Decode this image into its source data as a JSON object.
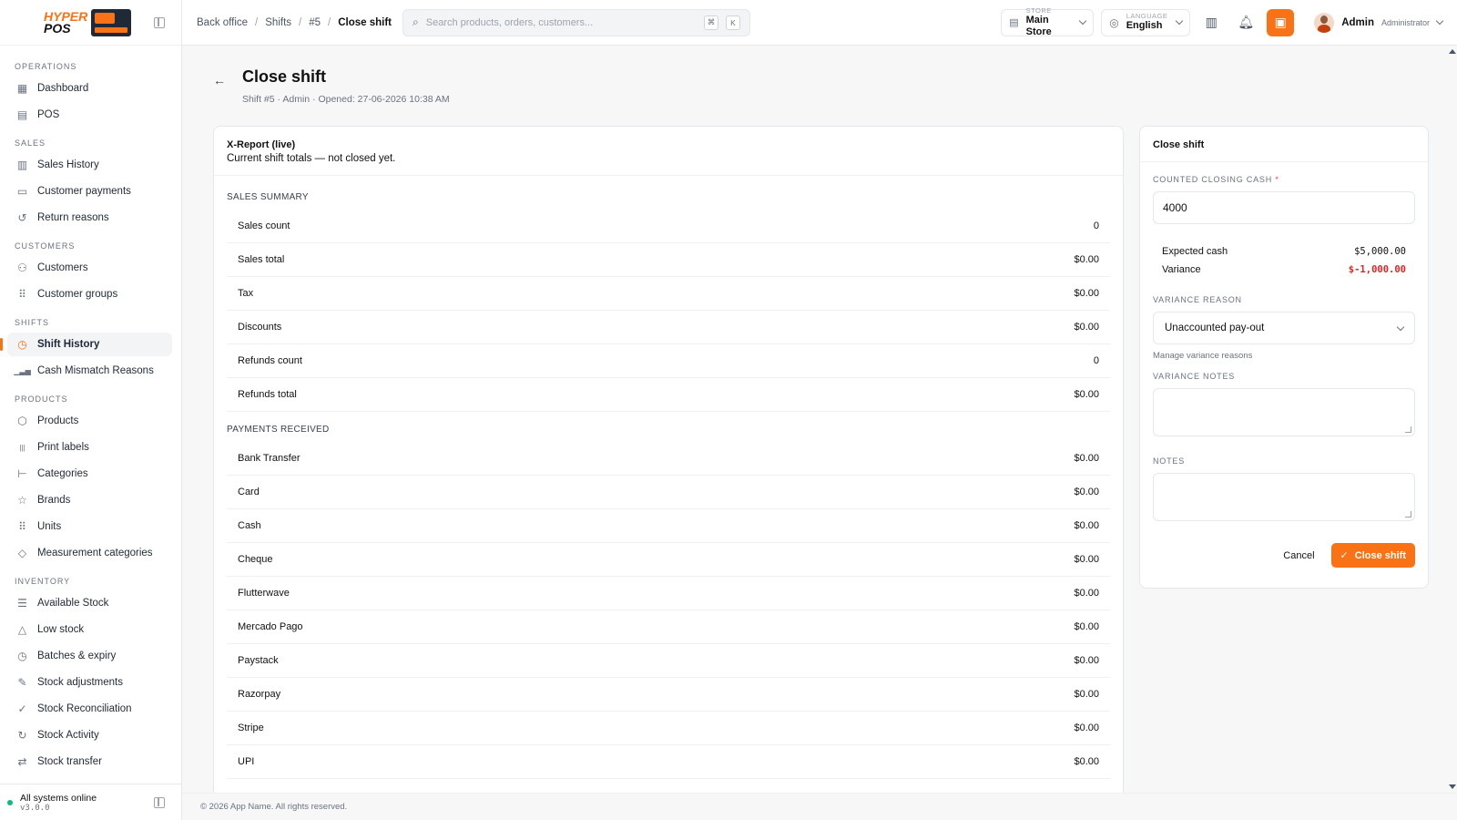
{
  "brand": {
    "logo_top": "HYPER",
    "logo_bottom": "POS"
  },
  "sidebar": {
    "sections": [
      {
        "title": "OPERATIONS",
        "items": [
          {
            "label": "Dashboard",
            "icon": "dashboard-icon",
            "glyph": "▦"
          },
          {
            "label": "POS",
            "icon": "pos-terminal-icon",
            "glyph": "▤"
          }
        ]
      },
      {
        "title": "SALES",
        "items": [
          {
            "label": "Sales History",
            "icon": "receipt-icon",
            "glyph": "▥"
          },
          {
            "label": "Customer payments",
            "icon": "cash-icon",
            "glyph": "▭"
          },
          {
            "label": "Return reasons",
            "icon": "undo-icon",
            "glyph": "↺"
          }
        ]
      },
      {
        "title": "CUSTOMERS",
        "items": [
          {
            "label": "Customers",
            "icon": "users-icon",
            "glyph": "⚇"
          },
          {
            "label": "Customer groups",
            "icon": "grip-icon",
            "glyph": "⠿"
          }
        ]
      },
      {
        "title": "SHIFTS",
        "items": [
          {
            "label": "Shift History",
            "icon": "clock-icon",
            "glyph": "◷",
            "active": true
          },
          {
            "label": "Cash Mismatch Reasons",
            "icon": "bar-chart-icon",
            "glyph": "▁▃▅"
          }
        ]
      },
      {
        "title": "PRODUCTS",
        "items": [
          {
            "label": "Products",
            "icon": "box-icon",
            "glyph": "⬡"
          },
          {
            "label": "Print labels",
            "icon": "barcode-icon",
            "glyph": "|||"
          },
          {
            "label": "Categories",
            "icon": "tree-icon",
            "glyph": "⊢"
          },
          {
            "label": "Brands",
            "icon": "star-icon",
            "glyph": "☆"
          },
          {
            "label": "Units",
            "icon": "grip-icon",
            "glyph": "⠿"
          },
          {
            "label": "Measurement categories",
            "icon": "tag-icon",
            "glyph": "◇"
          }
        ]
      },
      {
        "title": "INVENTORY",
        "items": [
          {
            "label": "Available Stock",
            "icon": "database-icon",
            "glyph": "☰"
          },
          {
            "label": "Low stock",
            "icon": "warning-icon",
            "glyph": "△"
          },
          {
            "label": "Batches & expiry",
            "icon": "clock-icon",
            "glyph": "◷"
          },
          {
            "label": "Stock adjustments",
            "icon": "edit-icon",
            "glyph": "✎"
          },
          {
            "label": "Stock Reconciliation",
            "icon": "check-double-icon",
            "glyph": "✓"
          },
          {
            "label": "Stock Activity",
            "icon": "refresh-icon",
            "glyph": "↻"
          },
          {
            "label": "Stock transfer",
            "icon": "transfer-icon",
            "glyph": "⇄"
          }
        ]
      }
    ],
    "status": "All systems online",
    "version": "v3.0.0"
  },
  "topbar": {
    "breadcrumb": [
      "Back office",
      "Shifts",
      "#5",
      "Close shift"
    ],
    "search_placeholder": "Search products, orders, customers...",
    "kbd": [
      "⌘",
      "K"
    ],
    "store_caption": "STORE",
    "store_value": "Main Store",
    "language_caption": "LANGUAGE",
    "language_value": "English",
    "user_name": "Admin",
    "user_role": "Administrator"
  },
  "page": {
    "title": "Close shift",
    "subtitle": "Shift #5 · Admin · Opened: 27-06-2026 10:38 AM"
  },
  "xreport": {
    "title": "X-Report (live)",
    "description": "Current shift totals — not closed yet.",
    "sales_label": "SALES SUMMARY",
    "sales": [
      {
        "k": "Sales count",
        "v": "0"
      },
      {
        "k": "Sales total",
        "v": "$0.00"
      },
      {
        "k": "Tax",
        "v": "$0.00"
      },
      {
        "k": "Discounts",
        "v": "$0.00"
      },
      {
        "k": "Refunds count",
        "v": "0"
      },
      {
        "k": "Refunds total",
        "v": "$0.00"
      }
    ],
    "payments_label": "PAYMENTS RECEIVED",
    "payments": [
      {
        "k": "Bank Transfer",
        "v": "$0.00"
      },
      {
        "k": "Card",
        "v": "$0.00"
      },
      {
        "k": "Cash",
        "v": "$0.00"
      },
      {
        "k": "Cheque",
        "v": "$0.00"
      },
      {
        "k": "Flutterwave",
        "v": "$0.00"
      },
      {
        "k": "Mercado Pago",
        "v": "$0.00"
      },
      {
        "k": "Paystack",
        "v": "$0.00"
      },
      {
        "k": "Razorpay",
        "v": "$0.00"
      },
      {
        "k": "Stripe",
        "v": "$0.00"
      },
      {
        "k": "UPI",
        "v": "$0.00"
      }
    ]
  },
  "close_form": {
    "title": "Close shift",
    "counted_label": "COUNTED CLOSING CASH",
    "counted_required": "*",
    "counted_value": "4000",
    "expected_label": "Expected cash",
    "expected_value": "$5,000.00",
    "variance_label": "Variance",
    "variance_value": "$-1,000.00",
    "variance_reason_label": "VARIANCE REASON",
    "variance_reason_value": "Unaccounted pay-out",
    "manage_link": "Manage variance reasons",
    "variance_notes_label": "VARIANCE NOTES",
    "notes_label": "NOTES",
    "cancel_label": "Cancel",
    "submit_label": "Close shift",
    "accent": "#f97316",
    "negative": "#dc2626"
  },
  "footer": {
    "text": "© 2026 App Name. All rights reserved."
  }
}
